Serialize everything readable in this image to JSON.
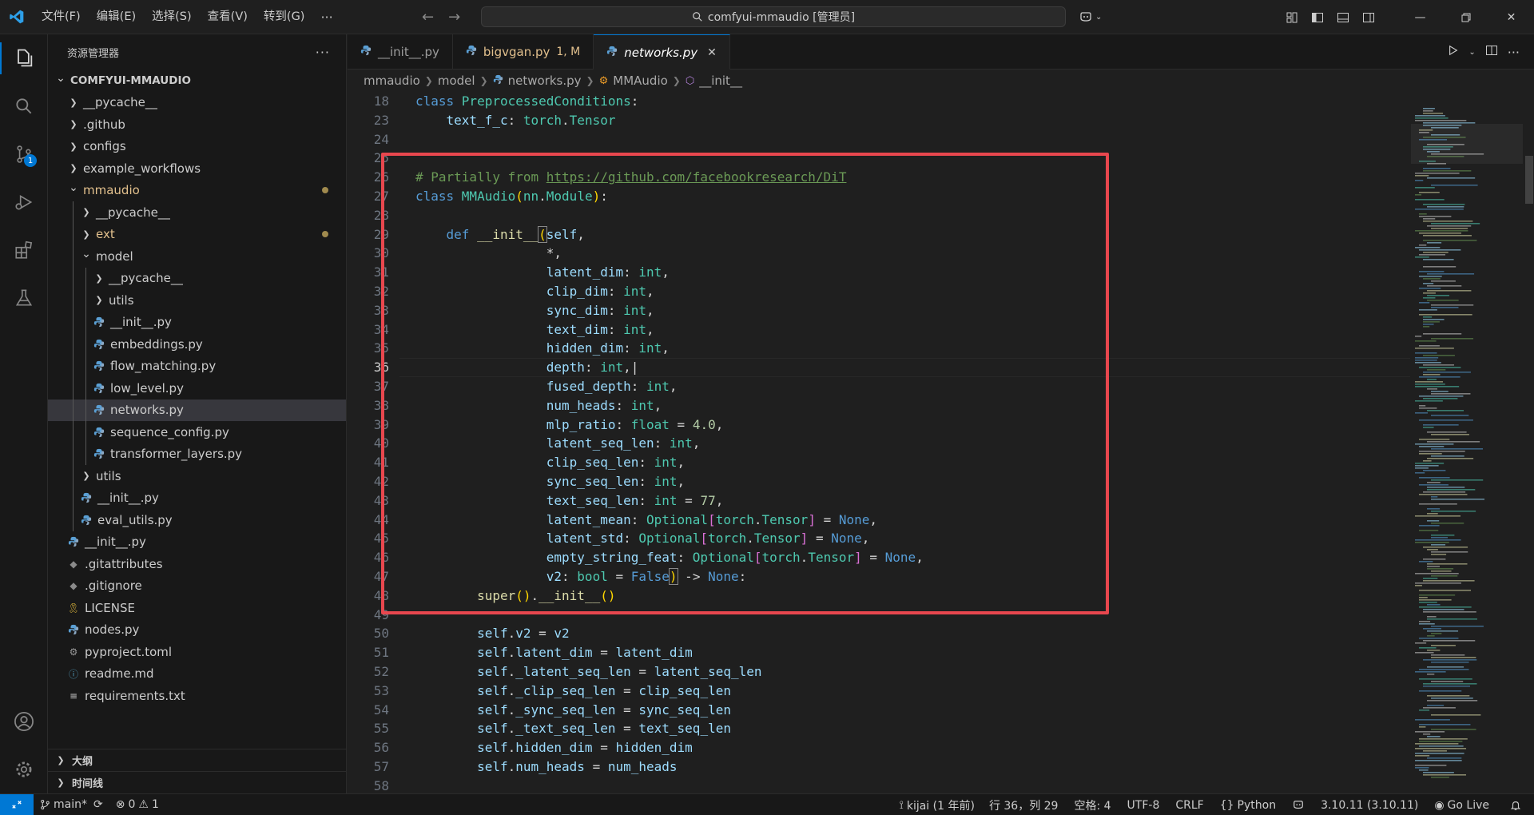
{
  "menu": [
    "文件(F)",
    "编辑(E)",
    "选择(S)",
    "查看(V)",
    "转到(G)"
  ],
  "menu_more": "···",
  "command_center": {
    "text": "comfyui-mmaudio [管理员]"
  },
  "sidebar": {
    "title": "资源管理器",
    "more": "···",
    "tree": [
      {
        "label": "COMFYUI-MMAUDIO",
        "depth": 0,
        "type": "root-open"
      },
      {
        "label": "__pycache__",
        "depth": 1,
        "type": "folder-closed"
      },
      {
        "label": ".github",
        "depth": 1,
        "type": "folder-closed"
      },
      {
        "label": "configs",
        "depth": 1,
        "type": "folder-closed"
      },
      {
        "label": "example_workflows",
        "depth": 1,
        "type": "folder-closed"
      },
      {
        "label": "mmaudio",
        "depth": 1,
        "type": "folder-open",
        "modified": true
      },
      {
        "label": "__pycache__",
        "depth": 2,
        "type": "folder-closed"
      },
      {
        "label": "ext",
        "depth": 2,
        "type": "folder-closed",
        "modified": true
      },
      {
        "label": "model",
        "depth": 2,
        "type": "folder-open"
      },
      {
        "label": "__pycache__",
        "depth": 3,
        "type": "folder-closed"
      },
      {
        "label": "utils",
        "depth": 3,
        "type": "folder-closed"
      },
      {
        "label": "__init__.py",
        "depth": 3,
        "type": "py"
      },
      {
        "label": "embeddings.py",
        "depth": 3,
        "type": "py"
      },
      {
        "label": "flow_matching.py",
        "depth": 3,
        "type": "py"
      },
      {
        "label": "low_level.py",
        "depth": 3,
        "type": "py"
      },
      {
        "label": "networks.py",
        "depth": 3,
        "type": "py",
        "selected": true
      },
      {
        "label": "sequence_config.py",
        "depth": 3,
        "type": "py"
      },
      {
        "label": "transformer_layers.py",
        "depth": 3,
        "type": "py"
      },
      {
        "label": "utils",
        "depth": 2,
        "type": "folder-closed"
      },
      {
        "label": "__init__.py",
        "depth": 2,
        "type": "py"
      },
      {
        "label": "eval_utils.py",
        "depth": 2,
        "type": "py"
      },
      {
        "label": "__init__.py",
        "depth": 1,
        "type": "py"
      },
      {
        "label": ".gitattributes",
        "depth": 1,
        "type": "git"
      },
      {
        "label": ".gitignore",
        "depth": 1,
        "type": "git"
      },
      {
        "label": "LICENSE",
        "depth": 1,
        "type": "license"
      },
      {
        "label": "nodes.py",
        "depth": 1,
        "type": "py"
      },
      {
        "label": "pyproject.toml",
        "depth": 1,
        "type": "toml"
      },
      {
        "label": "readme.md",
        "depth": 1,
        "type": "info"
      },
      {
        "label": "requirements.txt",
        "depth": 1,
        "type": "txt"
      }
    ],
    "sections": [
      "大纲",
      "时间线"
    ]
  },
  "tabs": [
    {
      "label": "__init__.py",
      "active": false,
      "modified": false,
      "suffix": ""
    },
    {
      "label": "bigvgan.py",
      "active": false,
      "modified": true,
      "suffix": "1, M"
    },
    {
      "label": "networks.py",
      "active": true,
      "modified": false,
      "suffix": ""
    }
  ],
  "tab_close": "✕",
  "breadcrumb": [
    "mmaudio",
    "model",
    "networks.py",
    "MMAudio",
    "__init__"
  ],
  "code": {
    "current_line": "36",
    "lines": [
      {
        "n": "18",
        "t": [
          [
            "k",
            "class "
          ],
          [
            "cl",
            "PreprocessedConditions"
          ],
          [
            "op",
            ":"
          ]
        ]
      },
      {
        "n": "23",
        "t": [
          [
            "op",
            "    "
          ],
          [
            "pm",
            "text_f_c"
          ],
          [
            "op",
            ": "
          ],
          [
            "cl",
            "torch"
          ],
          [
            "op",
            "."
          ],
          [
            "cl",
            "Tensor"
          ]
        ]
      },
      {
        "n": "24",
        "t": []
      },
      {
        "n": "25",
        "t": []
      },
      {
        "n": "26",
        "t": [
          [
            "cm",
            "# Partially from "
          ],
          [
            "lnk",
            "https://github.com/facebookresearch/DiT"
          ]
        ]
      },
      {
        "n": "27",
        "t": [
          [
            "k",
            "class "
          ],
          [
            "cl",
            "MMAudio"
          ],
          [
            "br",
            "("
          ],
          [
            "cl",
            "nn"
          ],
          [
            "op",
            "."
          ],
          [
            "cl",
            "Module"
          ],
          [
            "br",
            ")"
          ],
          [
            "op",
            ":"
          ]
        ]
      },
      {
        "n": "28",
        "t": []
      },
      {
        "n": "29",
        "t": [
          [
            "op",
            "    "
          ],
          [
            "k",
            "def "
          ],
          [
            "fn",
            "__init__"
          ],
          [
            "br",
            "(",
            "bx"
          ],
          [
            "pm",
            "self"
          ],
          [
            "op",
            ","
          ]
        ]
      },
      {
        "n": "30",
        "t": [
          [
            "op",
            "                 *,"
          ]
        ]
      },
      {
        "n": "31",
        "t": [
          [
            "op",
            "                 "
          ],
          [
            "pm",
            "latent_dim"
          ],
          [
            "op",
            ": "
          ],
          [
            "cl",
            "int"
          ],
          [
            "op",
            ","
          ]
        ]
      },
      {
        "n": "32",
        "t": [
          [
            "op",
            "                 "
          ],
          [
            "pm",
            "clip_dim"
          ],
          [
            "op",
            ": "
          ],
          [
            "cl",
            "int"
          ],
          [
            "op",
            ","
          ]
        ]
      },
      {
        "n": "33",
        "t": [
          [
            "op",
            "                 "
          ],
          [
            "pm",
            "sync_dim"
          ],
          [
            "op",
            ": "
          ],
          [
            "cl",
            "int"
          ],
          [
            "op",
            ","
          ]
        ]
      },
      {
        "n": "34",
        "t": [
          [
            "op",
            "                 "
          ],
          [
            "pm",
            "text_dim"
          ],
          [
            "op",
            ": "
          ],
          [
            "cl",
            "int"
          ],
          [
            "op",
            ","
          ]
        ]
      },
      {
        "n": "35",
        "t": [
          [
            "op",
            "                 "
          ],
          [
            "pm",
            "hidden_dim"
          ],
          [
            "op",
            ": "
          ],
          [
            "cl",
            "int"
          ],
          [
            "op",
            ","
          ]
        ]
      },
      {
        "n": "36",
        "t": [
          [
            "op",
            "                 "
          ],
          [
            "pm",
            "depth"
          ],
          [
            "op",
            ": "
          ],
          [
            "cl",
            "int"
          ],
          [
            "op",
            ",|"
          ]
        ]
      },
      {
        "n": "37",
        "t": [
          [
            "op",
            "                 "
          ],
          [
            "pm",
            "fused_depth"
          ],
          [
            "op",
            ": "
          ],
          [
            "cl",
            "int"
          ],
          [
            "op",
            ","
          ]
        ]
      },
      {
        "n": "38",
        "t": [
          [
            "op",
            "                 "
          ],
          [
            "pm",
            "num_heads"
          ],
          [
            "op",
            ": "
          ],
          [
            "cl",
            "int"
          ],
          [
            "op",
            ","
          ]
        ]
      },
      {
        "n": "39",
        "t": [
          [
            "op",
            "                 "
          ],
          [
            "pm",
            "mlp_ratio"
          ],
          [
            "op",
            ": "
          ],
          [
            "cl",
            "float"
          ],
          [
            "op",
            " = "
          ],
          [
            "nm",
            "4.0"
          ],
          [
            "op",
            ","
          ]
        ]
      },
      {
        "n": "40",
        "t": [
          [
            "op",
            "                 "
          ],
          [
            "pm",
            "latent_seq_len"
          ],
          [
            "op",
            ": "
          ],
          [
            "cl",
            "int"
          ],
          [
            "op",
            ","
          ]
        ]
      },
      {
        "n": "41",
        "t": [
          [
            "op",
            "                 "
          ],
          [
            "pm",
            "clip_seq_len"
          ],
          [
            "op",
            ": "
          ],
          [
            "cl",
            "int"
          ],
          [
            "op",
            ","
          ]
        ]
      },
      {
        "n": "42",
        "t": [
          [
            "op",
            "                 "
          ],
          [
            "pm",
            "sync_seq_len"
          ],
          [
            "op",
            ": "
          ],
          [
            "cl",
            "int"
          ],
          [
            "op",
            ","
          ]
        ]
      },
      {
        "n": "43",
        "t": [
          [
            "op",
            "                 "
          ],
          [
            "pm",
            "text_seq_len"
          ],
          [
            "op",
            ": "
          ],
          [
            "cl",
            "int"
          ],
          [
            "op",
            " = "
          ],
          [
            "nm",
            "77"
          ],
          [
            "op",
            ","
          ]
        ]
      },
      {
        "n": "44",
        "t": [
          [
            "op",
            "                 "
          ],
          [
            "pm",
            "latent_mean"
          ],
          [
            "op",
            ": "
          ],
          [
            "cl",
            "Optional"
          ],
          [
            "br2",
            "["
          ],
          [
            "cl",
            "torch"
          ],
          [
            "op",
            "."
          ],
          [
            "cl",
            "Tensor"
          ],
          [
            "br2",
            "]"
          ],
          [
            "op",
            " = "
          ],
          [
            "k",
            "None"
          ],
          [
            "op",
            ","
          ]
        ]
      },
      {
        "n": "45",
        "t": [
          [
            "op",
            "                 "
          ],
          [
            "pm",
            "latent_std"
          ],
          [
            "op",
            ": "
          ],
          [
            "cl",
            "Optional"
          ],
          [
            "br2",
            "["
          ],
          [
            "cl",
            "torch"
          ],
          [
            "op",
            "."
          ],
          [
            "cl",
            "Tensor"
          ],
          [
            "br2",
            "]"
          ],
          [
            "op",
            " = "
          ],
          [
            "k",
            "None"
          ],
          [
            "op",
            ","
          ]
        ]
      },
      {
        "n": "46",
        "t": [
          [
            "op",
            "                 "
          ],
          [
            "pm",
            "empty_string_feat"
          ],
          [
            "op",
            ": "
          ],
          [
            "cl",
            "Optional"
          ],
          [
            "br2",
            "["
          ],
          [
            "cl",
            "torch"
          ],
          [
            "op",
            "."
          ],
          [
            "cl",
            "Tensor"
          ],
          [
            "br2",
            "]"
          ],
          [
            "op",
            " = "
          ],
          [
            "k",
            "None"
          ],
          [
            "op",
            ","
          ]
        ]
      },
      {
        "n": "47",
        "t": [
          [
            "op",
            "                 "
          ],
          [
            "pm",
            "v2"
          ],
          [
            "op",
            ": "
          ],
          [
            "cl",
            "bool"
          ],
          [
            "op",
            " = "
          ],
          [
            "k",
            "False"
          ],
          [
            "br",
            ")",
            "bx"
          ],
          [
            "op",
            " -> "
          ],
          [
            "k",
            "None"
          ],
          [
            "op",
            ":"
          ]
        ]
      },
      {
        "n": "48",
        "t": [
          [
            "op",
            "        "
          ],
          [
            "fn",
            "super"
          ],
          [
            "br",
            "()"
          ],
          [
            "op",
            "."
          ],
          [
            "fn",
            "__init__"
          ],
          [
            "br",
            "()"
          ]
        ]
      },
      {
        "n": "49",
        "t": []
      },
      {
        "n": "50",
        "t": [
          [
            "op",
            "        "
          ],
          [
            "pm",
            "self"
          ],
          [
            "op",
            "."
          ],
          [
            "pm",
            "v2"
          ],
          [
            "op",
            " = "
          ],
          [
            "pm",
            "v2"
          ]
        ]
      },
      {
        "n": "51",
        "t": [
          [
            "op",
            "        "
          ],
          [
            "pm",
            "self"
          ],
          [
            "op",
            "."
          ],
          [
            "pm",
            "latent_dim"
          ],
          [
            "op",
            " = "
          ],
          [
            "pm",
            "latent_dim"
          ]
        ]
      },
      {
        "n": "52",
        "t": [
          [
            "op",
            "        "
          ],
          [
            "pm",
            "self"
          ],
          [
            "op",
            "."
          ],
          [
            "pm",
            "_latent_seq_len"
          ],
          [
            "op",
            " = "
          ],
          [
            "pm",
            "latent_seq_len"
          ]
        ]
      },
      {
        "n": "53",
        "t": [
          [
            "op",
            "        "
          ],
          [
            "pm",
            "self"
          ],
          [
            "op",
            "."
          ],
          [
            "pm",
            "_clip_seq_len"
          ],
          [
            "op",
            " = "
          ],
          [
            "pm",
            "clip_seq_len"
          ]
        ]
      },
      {
        "n": "54",
        "t": [
          [
            "op",
            "        "
          ],
          [
            "pm",
            "self"
          ],
          [
            "op",
            "."
          ],
          [
            "pm",
            "_sync_seq_len"
          ],
          [
            "op",
            " = "
          ],
          [
            "pm",
            "sync_seq_len"
          ]
        ]
      },
      {
        "n": "55",
        "t": [
          [
            "op",
            "        "
          ],
          [
            "pm",
            "self"
          ],
          [
            "op",
            "."
          ],
          [
            "pm",
            "_text_seq_len"
          ],
          [
            "op",
            " = "
          ],
          [
            "pm",
            "text_seq_len"
          ]
        ]
      },
      {
        "n": "56",
        "t": [
          [
            "op",
            "        "
          ],
          [
            "pm",
            "self"
          ],
          [
            "op",
            "."
          ],
          [
            "pm",
            "hidden_dim"
          ],
          [
            "op",
            " = "
          ],
          [
            "pm",
            "hidden_dim"
          ]
        ]
      },
      {
        "n": "57",
        "t": [
          [
            "op",
            "        "
          ],
          [
            "pm",
            "self"
          ],
          [
            "op",
            "."
          ],
          [
            "pm",
            "num_heads"
          ],
          [
            "op",
            " = "
          ],
          [
            "pm",
            "num_heads"
          ]
        ]
      },
      {
        "n": "58",
        "t": []
      }
    ]
  },
  "scm_badge": "1",
  "status": {
    "branch": "main*",
    "errors": "0",
    "warnings": "1",
    "blame": "kijai (1 年前)",
    "position": "行 36，列 29",
    "spaces": "空格: 4",
    "encoding": "UTF-8",
    "eol": "CRLF",
    "language": "Python",
    "interpreter": "3.10.11 (3.10.11)",
    "golive": "Go Live"
  },
  "colors": {
    "accent": "#0078d4",
    "highlight_box": "#e8474e",
    "modified": "#e2c08d"
  }
}
